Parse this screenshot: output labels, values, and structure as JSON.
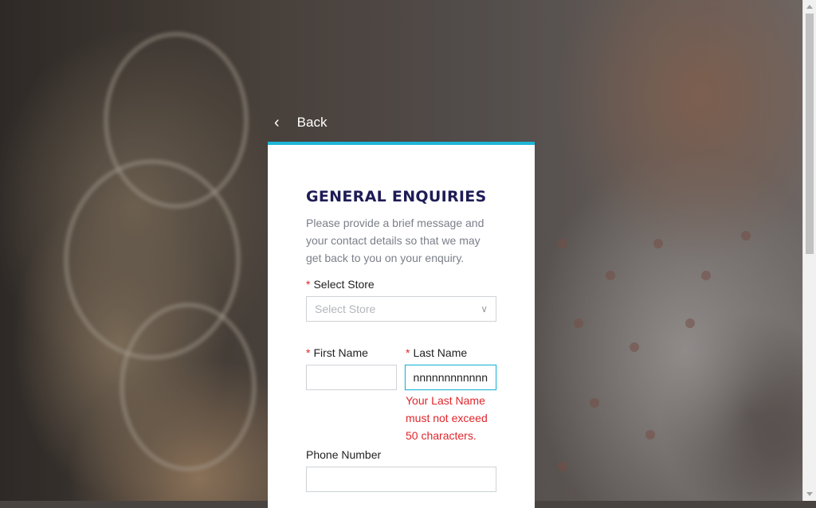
{
  "nav": {
    "back_label": "Back"
  },
  "form": {
    "title": "GENERAL ENQUIRIES",
    "intro": "Please provide a brief message and your contact details so that we may get back to you on your enquiry.",
    "required_marker": "*",
    "store": {
      "label": "Select Store",
      "placeholder": "Select Store"
    },
    "first_name": {
      "label": "First Name",
      "value": ""
    },
    "last_name": {
      "label": "Last Name",
      "value": "nnnnnnnnnnnnnn",
      "error": "Your Last Name must not exceed 50 characters."
    },
    "phone": {
      "label": "Phone Number",
      "value": ""
    }
  },
  "colors": {
    "accent": "#1eb6d8",
    "title": "#1e1c55",
    "error": "#e0262b"
  }
}
